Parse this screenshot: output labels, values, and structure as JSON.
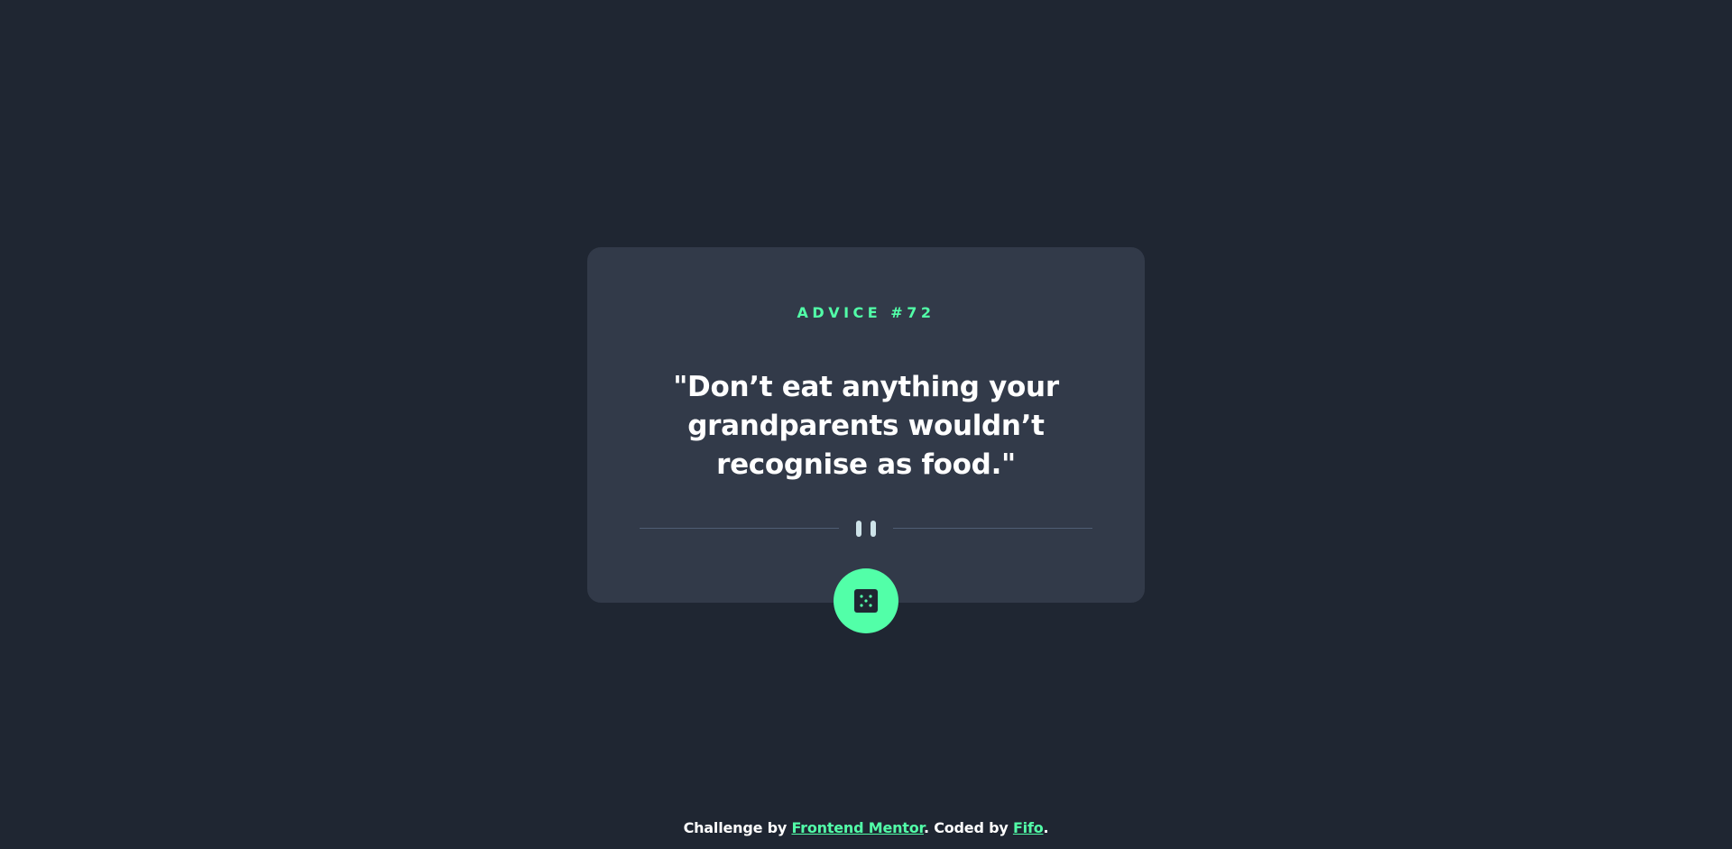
{
  "advice": {
    "label": "Advice #",
    "id": "72",
    "quote": "\"Don’t eat anything your grandparents wouldn’t recognise as food.\""
  },
  "dice_button": {
    "icon": "dice-icon"
  },
  "footer": {
    "prefix": "Challenge by ",
    "challenge_link": "Frontend Mentor",
    "middle": ". Coded by ",
    "author_link": "Fifo",
    "suffix": "."
  },
  "colors": {
    "background": "#1f2632",
    "card": "#323a49",
    "accent": "#52ffa8",
    "text": "#ffffff",
    "divider": "#4f5d74",
    "pause": "#cee3e9"
  }
}
